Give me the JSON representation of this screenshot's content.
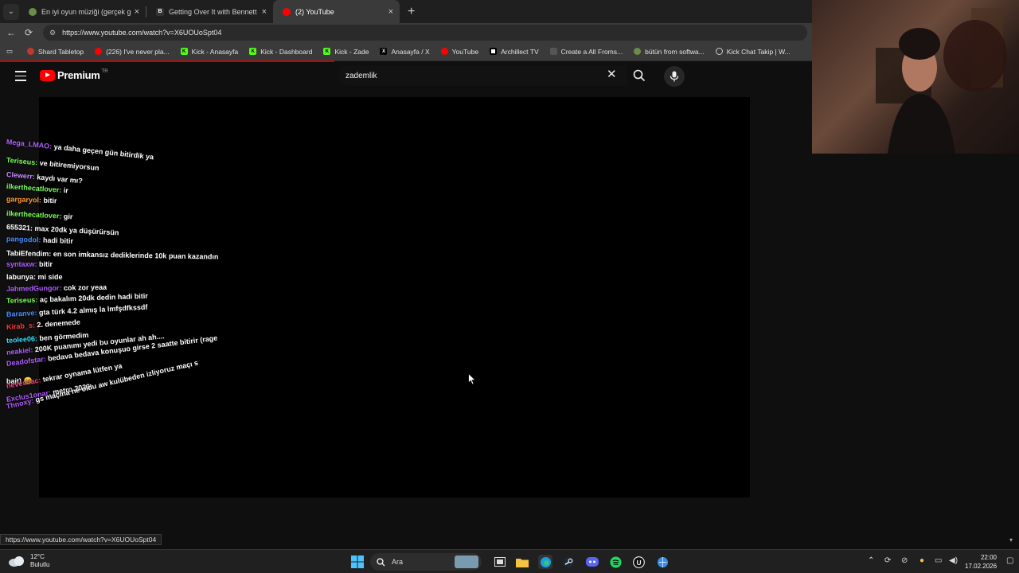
{
  "browser": {
    "tabs": [
      {
        "title": "En iyi oyun müziği (gerçek gamer",
        "active": false,
        "favicon_color": "#6a8d4a"
      },
      {
        "title": "Getting Over It with Bennett Fodd",
        "active": false,
        "favicon_color": "#3a3a3a"
      },
      {
        "title": "(2) YouTube",
        "active": true,
        "favicon_color": "#ff0000"
      }
    ],
    "url": "https://www.youtube.com/watch?v=X6UOUoSpt04",
    "bookmarks": [
      {
        "label": "Shard Tabletop",
        "color": "#c0392b"
      },
      {
        "label": "(226) I've never pla...",
        "color": "#ff0000"
      },
      {
        "label": "Kick - Anasayfa",
        "color": "#53fc18"
      },
      {
        "label": "Kick - Dashboard",
        "color": "#53fc18"
      },
      {
        "label": "Kick - Zade",
        "color": "#53fc18"
      },
      {
        "label": "Anasayfa / X",
        "color": "#000000"
      },
      {
        "label": "YouTube",
        "color": "#ff0000"
      },
      {
        "label": "Archillect TV",
        "color": "#ffffff"
      },
      {
        "label": "Create a All Froms...",
        "color": "#444444"
      },
      {
        "label": "bütün from softwa...",
        "color": "#6a8d4a"
      },
      {
        "label": "Kick Chat Takip | W...",
        "color": "#888888"
      }
    ]
  },
  "youtube": {
    "logo_text": "Premium",
    "region": "TR",
    "search_query": "zademlik"
  },
  "chat": [
    {
      "user": "Mega_LMAO:",
      "text": "ya daha geçen gün bitirdik ya",
      "color": "#b05cff"
    },
    {
      "user": "Teriseus:",
      "text": "ve bitiremiyorsun",
      "color": "#7bff5a"
    },
    {
      "user": "Clewerr:",
      "text": "kaydı var mı?",
      "color": "#c58bff"
    },
    {
      "user": "ilkerthecatlover:",
      "text": "ir",
      "color": "#7bff5a"
    },
    {
      "user": "gargaryol:",
      "text": "bitir",
      "color": "#ff9b3a"
    },
    {
      "user": "ilkerthecatlover:",
      "text": "gir",
      "color": "#7bff5a"
    },
    {
      "user": "655321:",
      "text": "max 20dk ya düşürürsün",
      "color": "#ffffff"
    },
    {
      "user": "pangodol:",
      "text": "hadi bitir",
      "color": "#4a8cff"
    },
    {
      "user": "TabiEfendim:",
      "text": "en son imkansız dediklerinde 10k puan kazandın",
      "color": "#ffffff"
    },
    {
      "user": "syntaxw:",
      "text": "bitir",
      "color": "#b05cff"
    },
    {
      "user": "labunya:",
      "text": "mi side",
      "color": "#ffffff"
    },
    {
      "user": "JahmedGungor:",
      "text": "cok zor yeaa",
      "color": "#b05cff"
    },
    {
      "user": "Teriseus:",
      "text": "aç bakalım 20dk dedin hadi bitir",
      "color": "#7bff5a"
    },
    {
      "user": "Baranve:",
      "text": "gta türk 4.2 almış la lmfşdfkssdf",
      "color": "#4a8cff"
    },
    {
      "user": "Kirab_s:",
      "text": "2. denemede",
      "color": "#ff3a3a"
    },
    {
      "user": "teolee06:",
      "text": "ben görmedim",
      "color": "#3ae0ff"
    },
    {
      "user": "neakiel:",
      "text": "200K puanımı yedi bu oyunlar ah ah....",
      "color": "#b05cff"
    },
    {
      "user": "Deadofstar:",
      "text": "bedava bedava konuşuo girse 2 saatte bitirir (rage",
      "color": "#b05cff"
    },
    {
      "user": "",
      "text": "bait) 😊",
      "color": "#ffffff"
    },
    {
      "user": "nevesnac:",
      "text": "tekrar oynama lütfen ya",
      "color": "#ff3a8a"
    },
    {
      "user": "Exclus1onar:",
      "text": "metro 2033",
      "color": "#b05cff"
    },
    {
      "user": "Thnoxy:",
      "text": "gs maçına ne oldu aw kulübeden izliyoruz maçı s",
      "color": "#b05cff"
    }
  ],
  "status_url": "https://www.youtube.com/watch?v=X6UOUoSpt04",
  "taskbar": {
    "weather_temp": "12°C",
    "weather_desc": "Bulutlu",
    "search_placeholder": "Ara",
    "time": "22:00",
    "date": "17.02.2026"
  },
  "icons": {
    "tab_close": "×",
    "new_tab": "+",
    "back": "←",
    "reload": "⟳",
    "search_clear": "✕"
  }
}
